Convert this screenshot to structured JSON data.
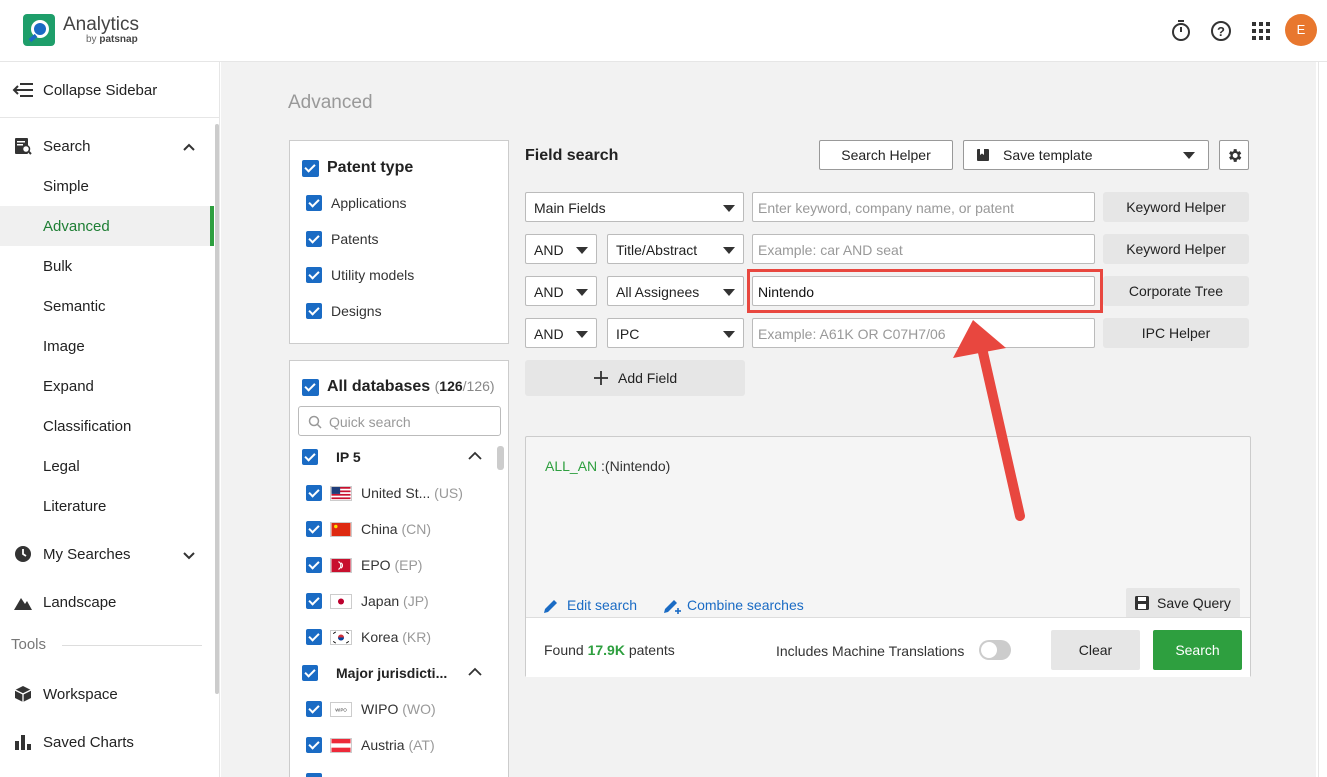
{
  "header": {
    "app_title": "Analytics",
    "app_sub_prefix": "by ",
    "app_sub_brand": "patsnap",
    "avatar_initial": "E"
  },
  "sidebar": {
    "collapse_label": "Collapse Sidebar",
    "search_label": "Search",
    "search_items": [
      {
        "label": "Simple"
      },
      {
        "label": "Advanced"
      },
      {
        "label": "Bulk"
      },
      {
        "label": "Semantic"
      },
      {
        "label": "Image"
      },
      {
        "label": "Expand"
      },
      {
        "label": "Classification"
      },
      {
        "label": "Legal"
      },
      {
        "label": "Literature"
      }
    ],
    "active_item": "Advanced",
    "my_searches_label": "My Searches",
    "landscape_label": "Landscape",
    "tools_label": "Tools",
    "workspace_label": "Workspace",
    "saved_charts_label": "Saved Charts"
  },
  "page": {
    "title": "Advanced"
  },
  "patent_type": {
    "title": "Patent type",
    "items": [
      {
        "label": "Applications",
        "checked": true
      },
      {
        "label": "Patents",
        "checked": true
      },
      {
        "label": "Utility models",
        "checked": true
      },
      {
        "label": "Designs",
        "checked": true
      }
    ]
  },
  "databases": {
    "title": "All databases",
    "count_selected": "126",
    "count_total": "/126",
    "search_placeholder": "Quick search",
    "group1": {
      "label": "IP 5"
    },
    "group1_items": [
      {
        "name": "United St...",
        "code": "(US)"
      },
      {
        "name": "China",
        "code": "(CN)"
      },
      {
        "name": "EPO",
        "code": "(EP)"
      },
      {
        "name": "Japan",
        "code": "(JP)"
      },
      {
        "name": "Korea",
        "code": "(KR)"
      }
    ],
    "group2": {
      "label": "Major jurisdicti..."
    },
    "group2_items": [
      {
        "name": "WIPO",
        "code": "(WO)"
      },
      {
        "name": "Austria",
        "code": "(AT)"
      }
    ]
  },
  "field_search": {
    "title": "Field search",
    "search_helper": "Search Helper",
    "save_template": "Save template",
    "rows": [
      {
        "operator": "",
        "field": "Main Fields",
        "placeholder": "Enter keyword, company name, or patent",
        "value": "",
        "helper": "Keyword Helper"
      },
      {
        "operator": "AND",
        "field": "Title/Abstract",
        "placeholder": "Example: car AND seat",
        "value": "",
        "helper": "Keyword Helper"
      },
      {
        "operator": "AND",
        "field": "All Assignees",
        "placeholder": "",
        "value": "Nintendo",
        "helper": "Corporate Tree"
      },
      {
        "operator": "AND",
        "field": "IPC",
        "placeholder": "Example: A61K OR C07H7/06",
        "value": "",
        "helper": "IPC Helper"
      }
    ],
    "add_field": "Add Field"
  },
  "query": {
    "field_code": "ALL_AN",
    "expression": " :(Nintendo)",
    "edit_search": "Edit search",
    "combine_searches": "Combine searches",
    "save_query": "Save Query",
    "found_prefix": "Found ",
    "found_count": "17.9K",
    "found_suffix": " patents",
    "machine_translations": "Includes Machine Translations",
    "machine_translations_on": false,
    "clear": "Clear",
    "search": "Search"
  },
  "colors": {
    "accent_green": "#2e9f3f",
    "link_blue": "#1a6bc4",
    "highlight_red": "#e8473f",
    "avatar_orange": "#e8772e"
  }
}
